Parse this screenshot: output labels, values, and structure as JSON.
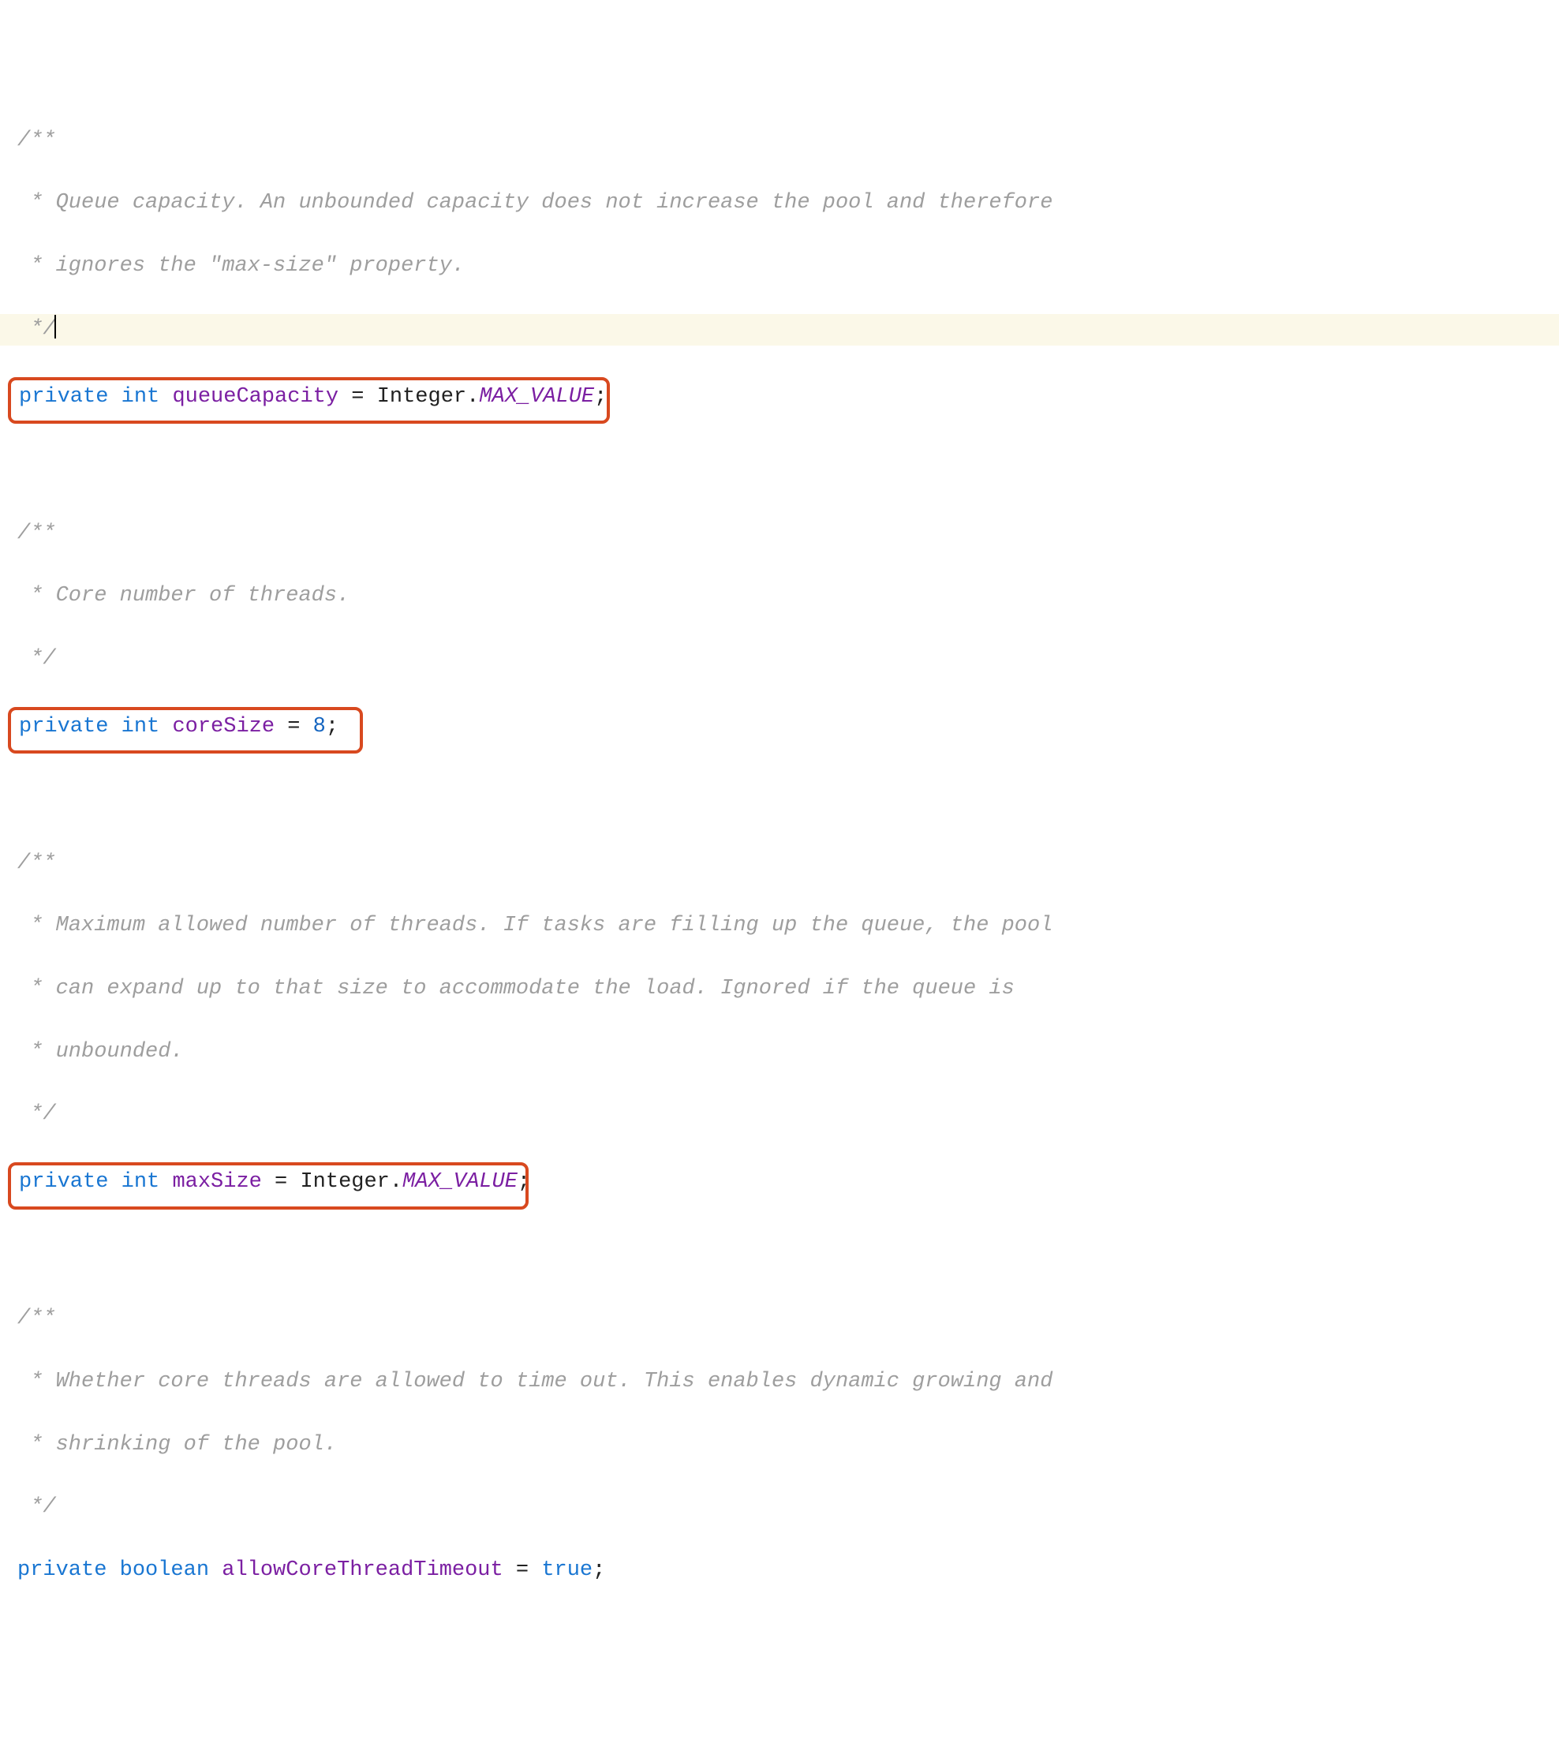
{
  "code": {
    "c1a": "/**",
    "c1b": " * Queue capacity. An unbounded capacity does not increase the pool and therefore",
    "c1c": " * ignores the \"max-size\" property.",
    "c1d": " */",
    "l1_private": "private",
    "l1_int": "int",
    "l1_member": "queueCapacity",
    "l1_eq": " = ",
    "l1_type": "Integer",
    "l1_dot": ".",
    "l1_const": "MAX_VALUE",
    "l1_semi": ";",
    "c2a": "/**",
    "c2b": " * Core number of threads.",
    "c2c": " */",
    "l2_private": "private",
    "l2_int": "int",
    "l2_member": "coreSize",
    "l2_eq": " = ",
    "l2_num": "8",
    "l2_semi": ";",
    "c3a": "/**",
    "c3b": " * Maximum allowed number of threads. If tasks are filling up the queue, the pool",
    "c3c": " * can expand up to that size to accommodate the load. Ignored if the queue is",
    "c3d": " * unbounded.",
    "c3e": " */",
    "l3_private": "private",
    "l3_int": "int",
    "l3_member": "maxSize",
    "l3_eq": " = ",
    "l3_type": "Integer",
    "l3_dot": ".",
    "l3_const": "MAX_VALUE",
    "l3_semi": ";",
    "c4a": "/**",
    "c4b": " * Whether core threads are allowed to time out. This enables dynamic growing and",
    "c4c": " * shrinking of the pool.",
    "c4d": " */",
    "l4_private": "private",
    "l4_boolean": "boolean",
    "l4_member": "allowCoreThreadTimeout",
    "l4_eq": " = ",
    "l4_bool": "true",
    "l4_semi": ";"
  },
  "annotations": {
    "boxes": [
      "queueCapacity declaration",
      "coreSize declaration",
      "maxSize declaration"
    ]
  },
  "colors": {
    "annotation_border": "#d8491f",
    "current_line": "#fbf8e8",
    "keyword": "#1976d2",
    "member": "#7b1fa2",
    "comment": "#9e9e9e"
  }
}
